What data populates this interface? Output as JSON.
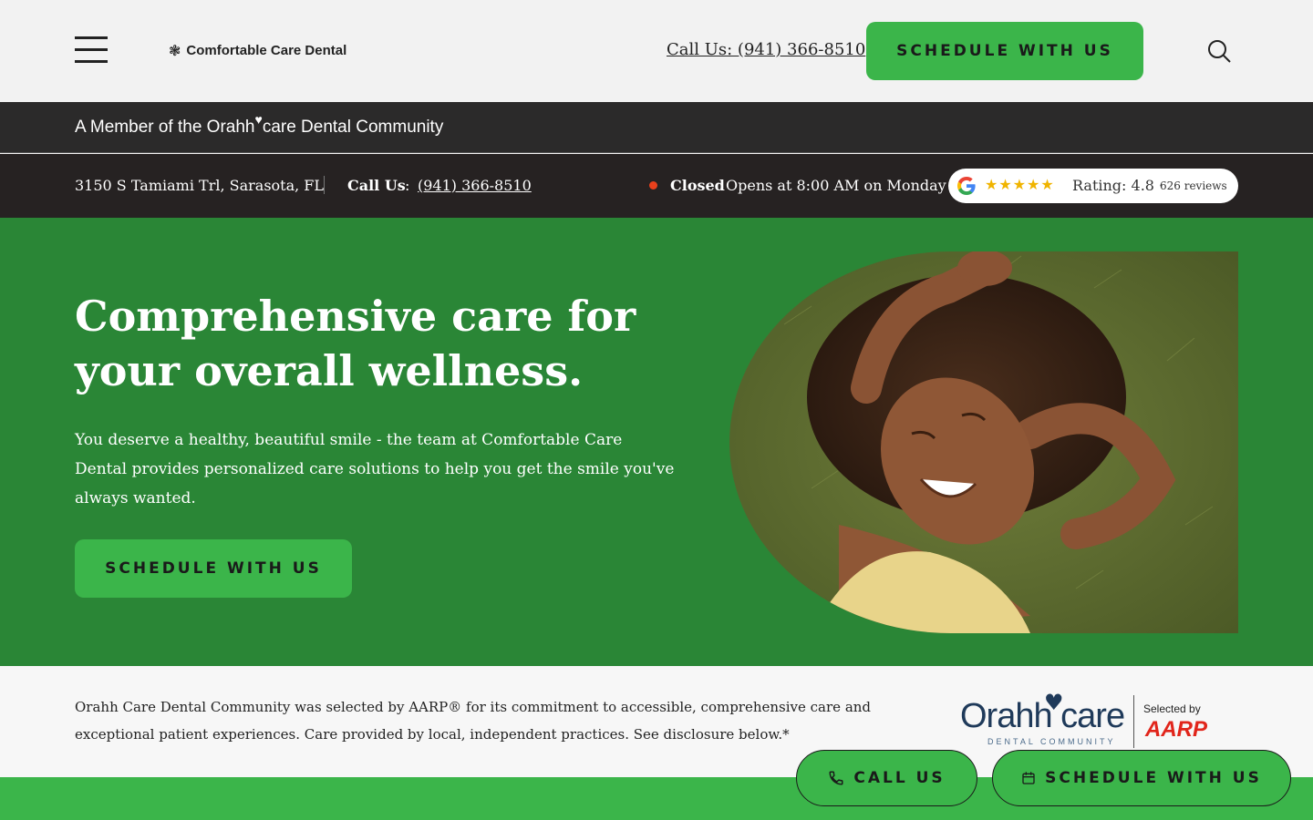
{
  "header": {
    "logo_mark": "❃",
    "logo_text": "Comfortable Care Dental",
    "call_label": "Call Us: (941) 366-8510",
    "schedule_label": "SCHEDULE WITH US"
  },
  "member_bar": {
    "prefix": "A Member of the Orahh",
    "heart": "♥",
    "suffix": "care Dental Community"
  },
  "info_bar": {
    "address": "3150 S Tamiami Trl, Sarasota, FL",
    "call_label": "Call Us",
    "call_colon": ":",
    "call_number": "(941) 366-8510",
    "status_closed": "Closed",
    "status_open": "Opens at 8:00 AM on Monday",
    "stars": "★★★★★",
    "rating_text": "Rating: 4.8 ·",
    "reviews": "626 reviews",
    "rating_value": 4.8
  },
  "hero": {
    "title": "Comprehensive care for your overall wellness.",
    "body": "You deserve a healthy, beautiful smile - the team at Comfortable Care Dental provides personalized care solutions to help you get the smile you've always wanted.",
    "button": "SCHEDULE WITH US"
  },
  "aarp": {
    "text": "Orahh Care Dental Community was selected by AARP® for its commitment to accessible, comprehensive care and exceptional patient experiences. Care provided by local, independent practices. See disclosure below.*",
    "logo_word": "Orahh care",
    "logo_sub": "DENTAL COMMUNITY",
    "selected_by": "Selected by",
    "aarp_logo": "AARP"
  },
  "floating": {
    "call_label": "CALL US",
    "schedule_label": "SCHEDULE WITH US"
  },
  "colors": {
    "brand_green": "#3bb54a",
    "hero_green": "#2a8636",
    "dark_bar": "#262222",
    "aarp_red": "#e1251b",
    "orahh_navy": "#1f3a5a"
  }
}
